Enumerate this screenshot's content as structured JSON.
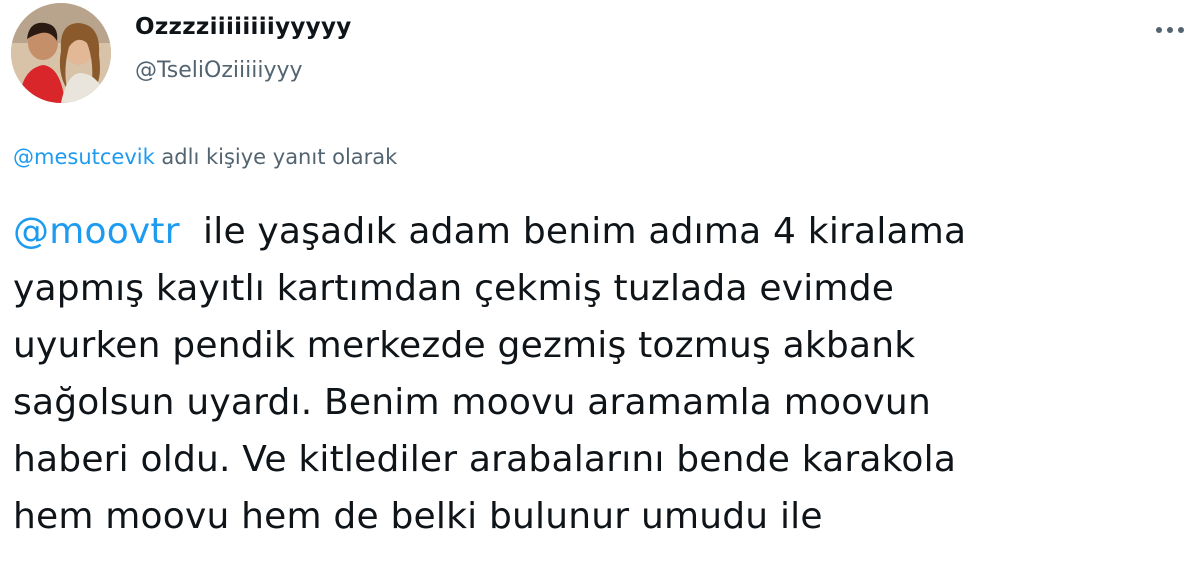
{
  "author": {
    "display_name": "Ozzzziiiiiiiiyyyyy",
    "handle": "@TseliOziiiiiyyy",
    "avatar_icon": "profile-photo"
  },
  "menu": {
    "more_icon": "more-horizontal-icon"
  },
  "reply_context": {
    "mention": "@mesutcevik",
    "text": " adlı kişiye yanıt olarak"
  },
  "tweet": {
    "mention": "@moovtr",
    "lines": [
      "  ile yaşadık adam benim adıma 4 kiralama",
      "yapmış kayıtlı kartımdan çekmiş tuzlada evimde",
      "uyurken pendik merkezde gezmiş tozmuş akbank",
      "sağolsun uyardı. Benim moovu aramamla moovun",
      "haberi oldu. Ve kitlediler arabalarını bende karakola",
      "hem moovu hem de belki bulunur umudu ile"
    ]
  },
  "colors": {
    "link": "#1d9bf0",
    "text": "#0f1419",
    "secondary": "#536471"
  }
}
